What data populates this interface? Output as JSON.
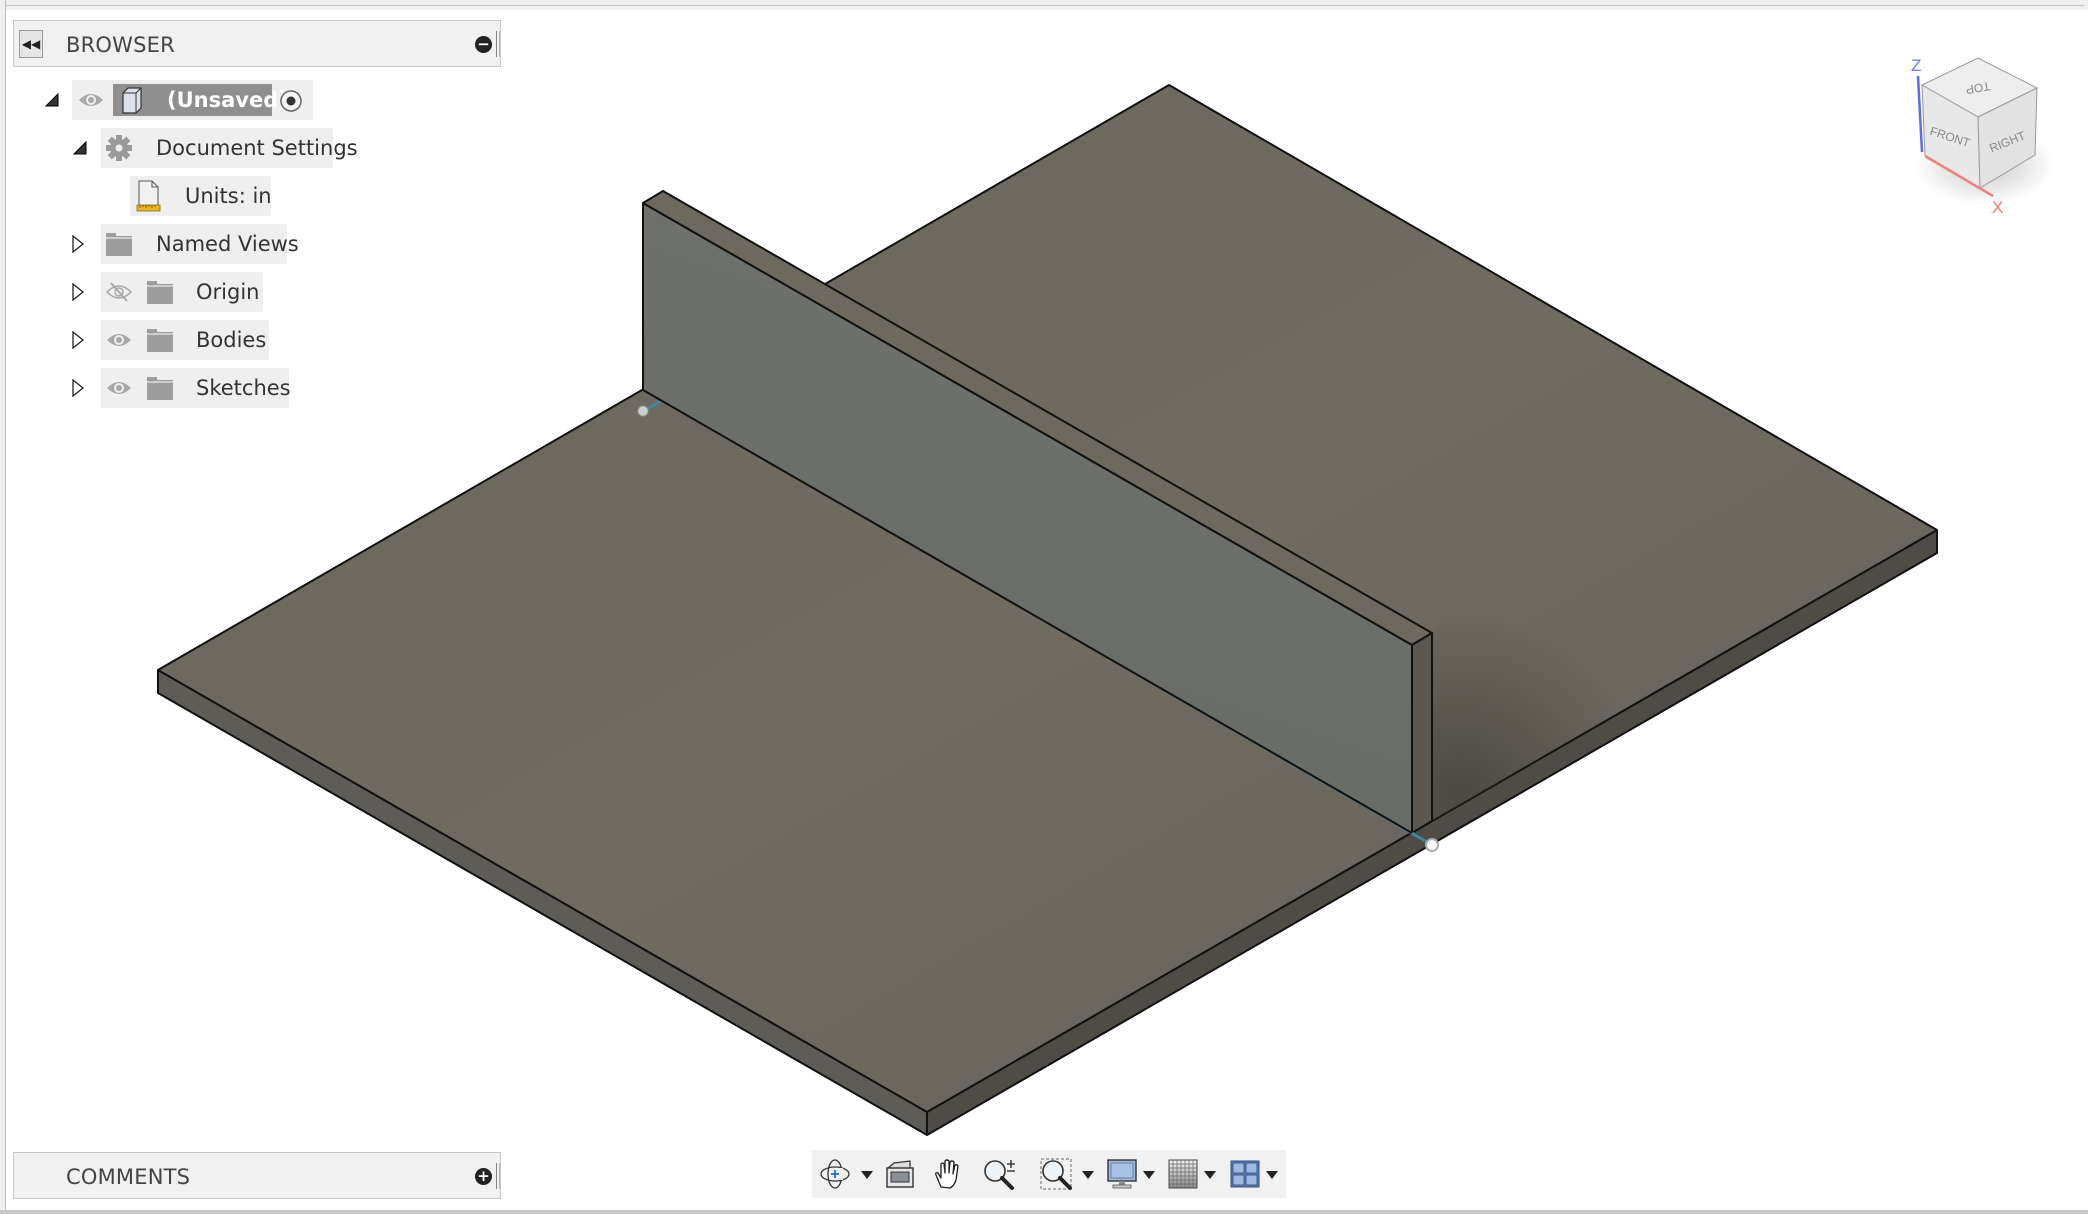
{
  "browser": {
    "title": "BROWSER",
    "collapse_icon": "rewind-icon",
    "header_action_icon": "minus-circle-icon",
    "tree": {
      "root": {
        "label": "(Unsaved)",
        "expanded": true,
        "visible": true,
        "active": true
      },
      "document_settings": {
        "label": "Document Settings",
        "expanded": true
      },
      "units": {
        "label": "Units: in"
      },
      "named_views": {
        "label": "Named Views",
        "expanded": false
      },
      "origin": {
        "label": "Origin",
        "expanded": false,
        "visible": false
      },
      "bodies": {
        "label": "Bodies",
        "expanded": false,
        "visible": true
      },
      "sketches": {
        "label": "Sketches",
        "expanded": false,
        "visible": true
      }
    }
  },
  "comments": {
    "title": "COMMENTS",
    "header_action_icon": "plus-circle-icon"
  },
  "viewcube": {
    "faces": {
      "top": "TOP",
      "front": "FRONT",
      "right": "RIGHT"
    },
    "axes": {
      "z": "Z",
      "x": "X"
    },
    "colors": {
      "z_axis": "#5a6cf0",
      "x_axis": "#f07a7a"
    }
  },
  "navbar": {
    "tools": [
      {
        "name": "orbit",
        "icon": "orbit-icon",
        "has_dropdown": true
      },
      {
        "name": "look-at",
        "icon": "look-at-icon",
        "has_dropdown": false
      },
      {
        "name": "pan",
        "icon": "pan-hand-icon",
        "has_dropdown": false
      },
      {
        "name": "zoom",
        "icon": "zoom-icon",
        "has_dropdown": false
      },
      {
        "name": "fit",
        "icon": "zoom-window-icon",
        "has_dropdown": true
      },
      {
        "name": "display-settings",
        "icon": "monitor-icon",
        "has_dropdown": true
      },
      {
        "name": "grid-and-snaps",
        "icon": "grid-icon",
        "has_dropdown": true
      },
      {
        "name": "viewports",
        "icon": "viewports-icon",
        "has_dropdown": true
      }
    ]
  },
  "model": {
    "colors": {
      "plate_top": "#6b665c",
      "plate_side_left": "#5b5a54",
      "plate_side_right": "#504d46",
      "wall_face": "#6c6e6a",
      "wall_top": "#6b665c",
      "wall_end": "#59574f",
      "edge": "#111111",
      "sketch_line": "#3e86a8"
    }
  }
}
